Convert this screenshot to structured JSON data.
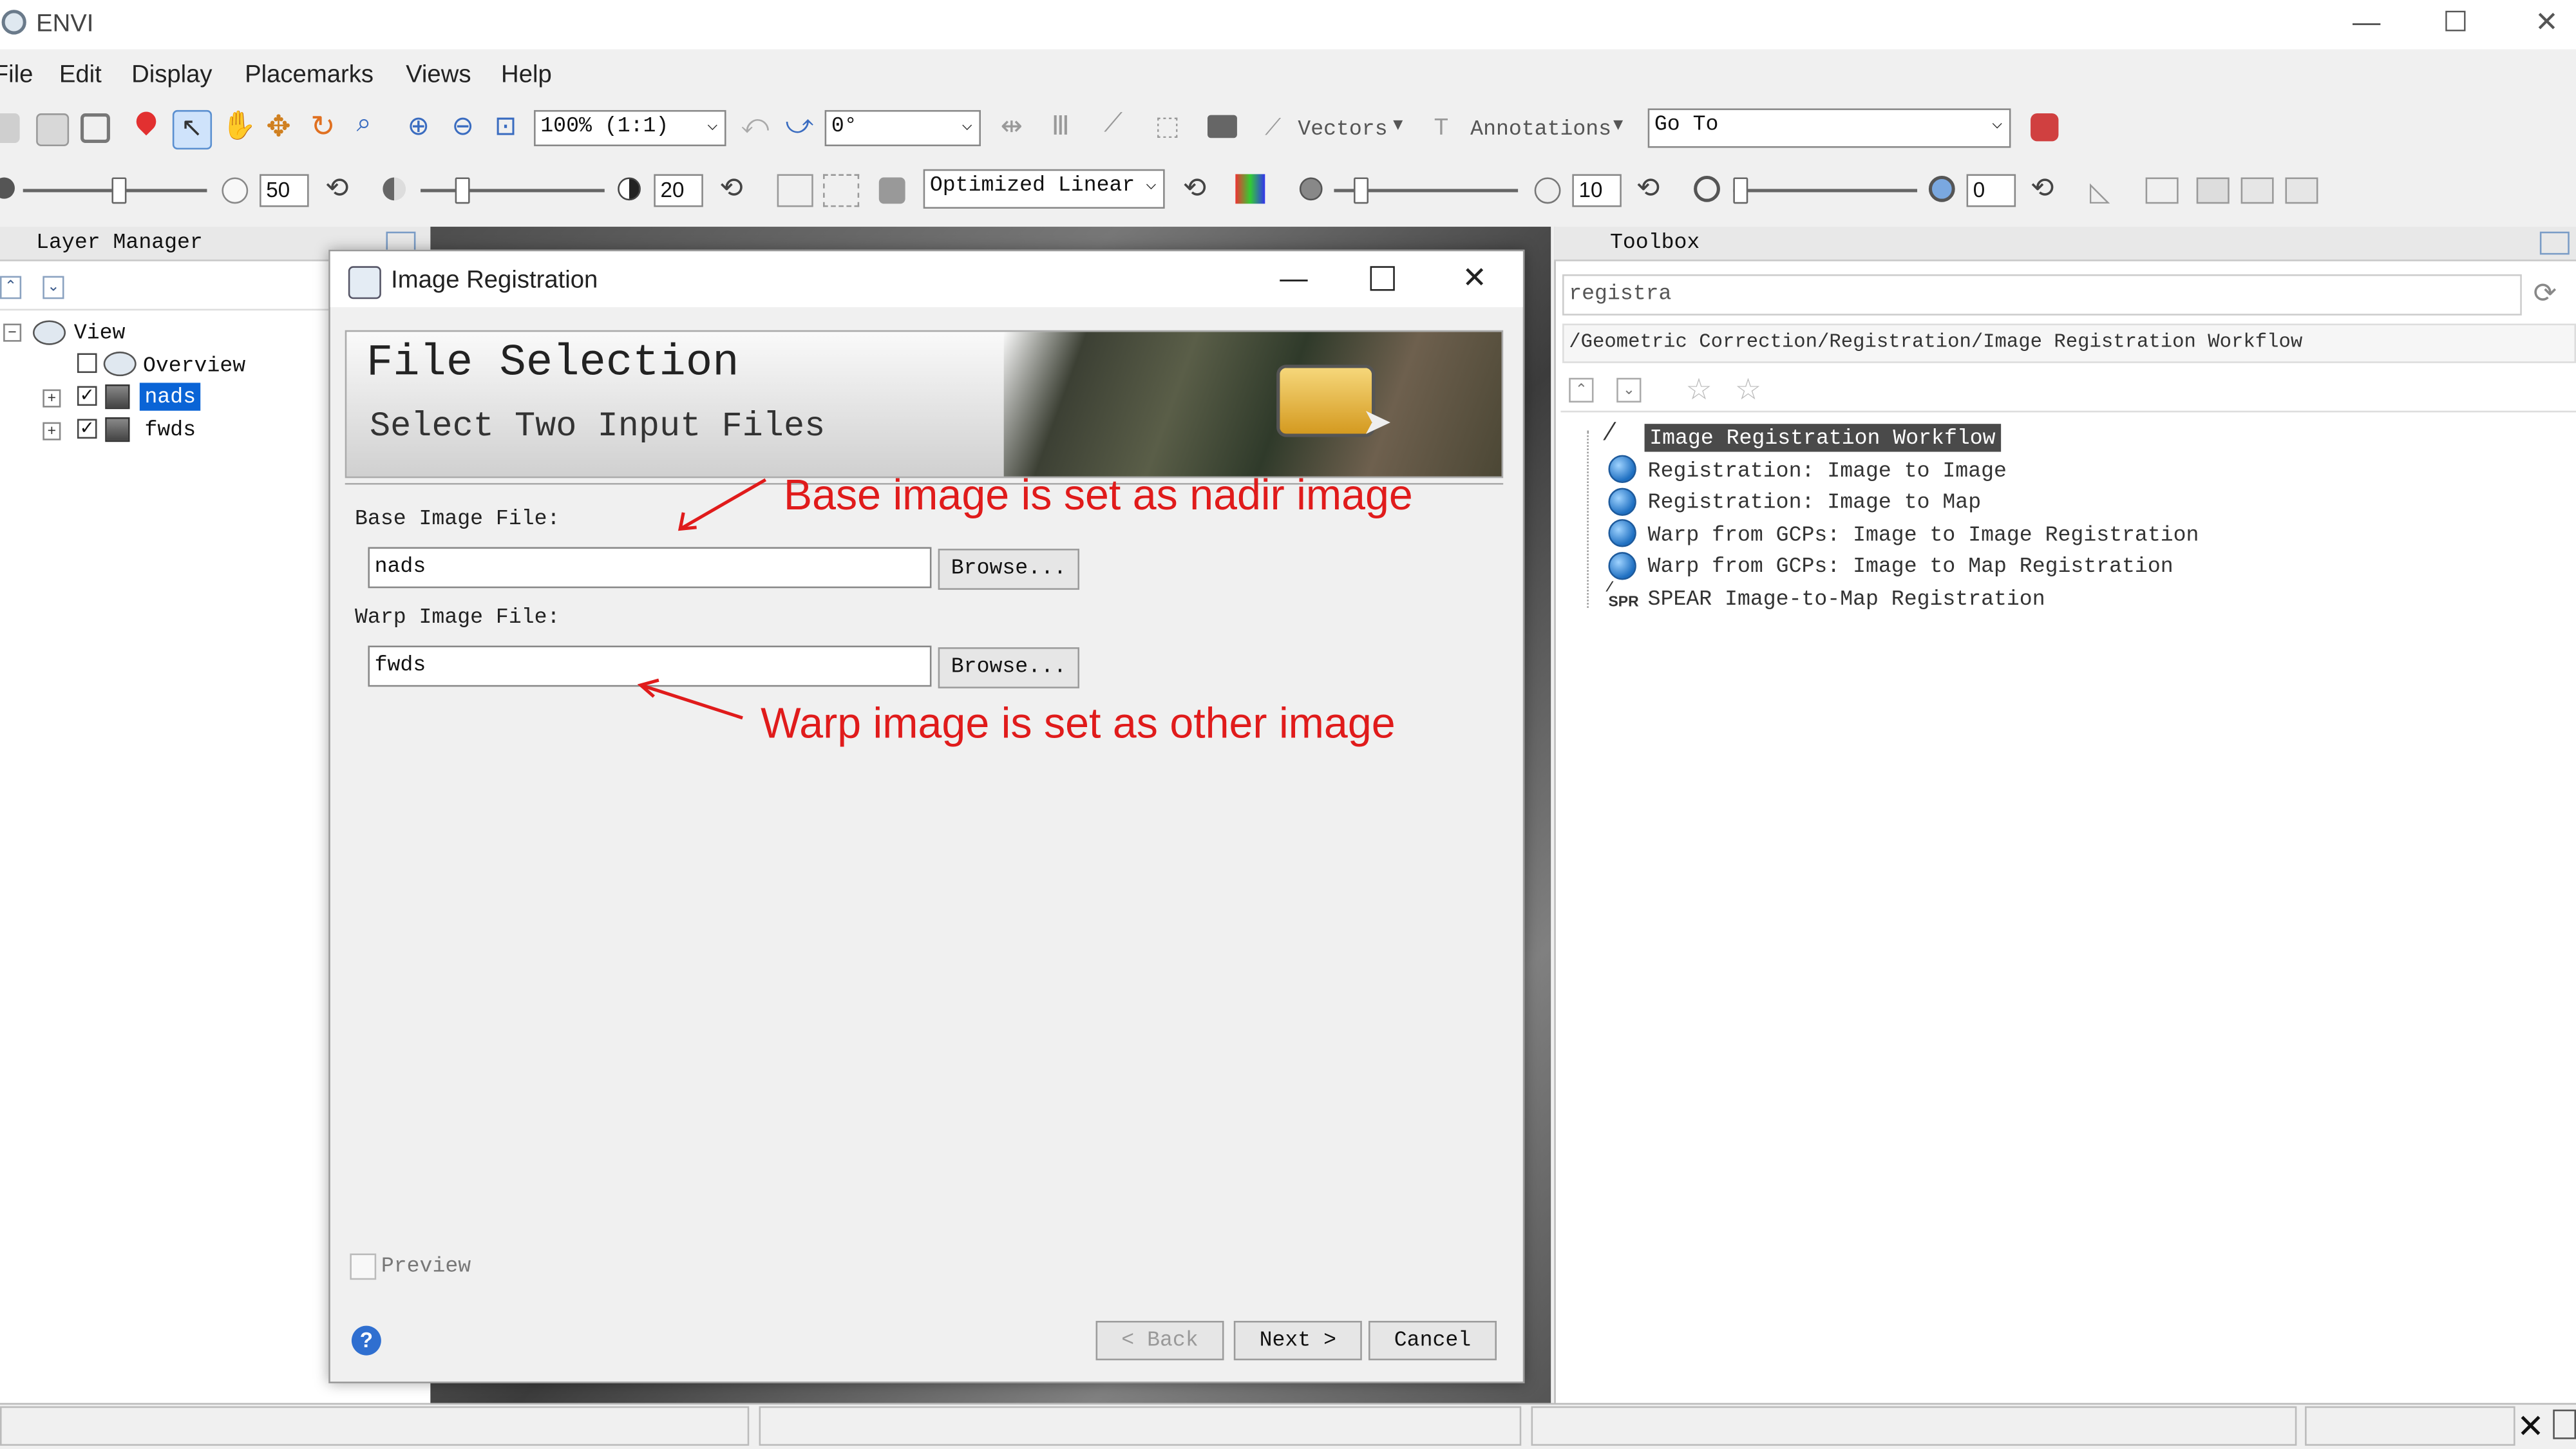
{
  "app": {
    "title": "ENVI"
  },
  "window_controls": {
    "minimize": "—",
    "maximize": "☐",
    "close": "✕"
  },
  "menu": [
    "File",
    "Edit",
    "Display",
    "Placemarks",
    "Views",
    "Help"
  ],
  "toolbar1": {
    "zoom": "100% (1:1)",
    "rotation": "0°",
    "vectors_label": "Vectors",
    "annotations_label": "Annotations",
    "goto": "Go To"
  },
  "toolbar2": {
    "brightness": "50",
    "contrast": "20",
    "stretch": "Optimized Linear",
    "sharpen": "10",
    "transparency": "0"
  },
  "layer_manager": {
    "title": "Layer Manager",
    "items": {
      "view": "View",
      "overview": "Overview",
      "nads": "nads",
      "fwds": "fwds"
    }
  },
  "toolbox": {
    "title": "Toolbox",
    "search": "registra",
    "path": "/Geometric Correction/Registration/Image Registration Workflow",
    "items": [
      "Image Registration Workflow",
      "Registration: Image to Image",
      "Registration: Image to Map",
      "Warp from GCPs: Image to Image Registration",
      "Warp from GCPs: Image to Map Registration",
      "SPEAR Image-to-Map Registration"
    ],
    "spear_icon_text": "SPR"
  },
  "dialog": {
    "title": "Image Registration",
    "banner_title": "File Selection",
    "banner_subtitle": "Select Two Input Files",
    "base_label": "Base Image File:",
    "base_value": "nads",
    "warp_label": "Warp Image File:",
    "warp_value": "fwds",
    "browse": "Browse...",
    "preview": "Preview",
    "back": "< Back",
    "next": "Next >",
    "cancel": "Cancel"
  },
  "annotations": {
    "base_note": "Base image is set as nadir image",
    "warp_note": "Warp image is set as other image",
    "color": "#e01b1b"
  },
  "colors": {
    "selection": "#0a64d6",
    "dialog_bg": "#f0f0f0",
    "highlight_item": "#4a4a4a"
  }
}
